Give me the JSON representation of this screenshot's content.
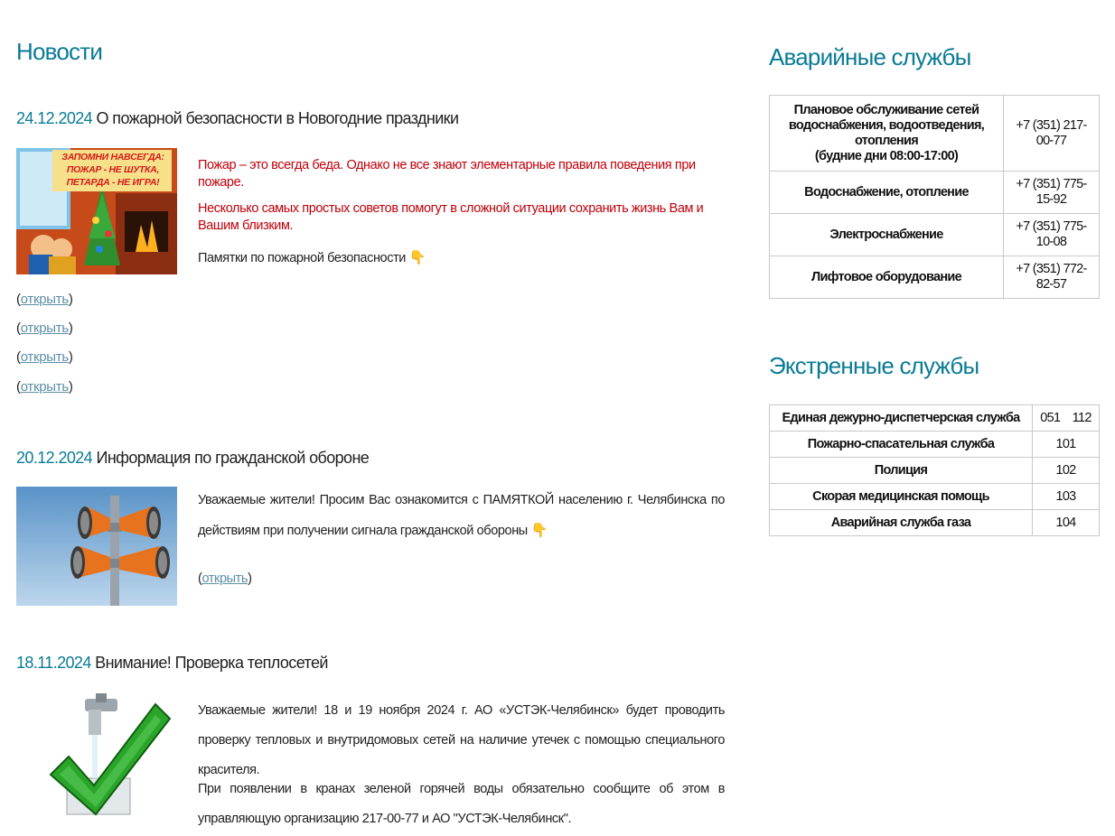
{
  "news": {
    "section_title": "Новости",
    "items": [
      {
        "date": "24.12.2024",
        "title": "О пожарной безопасности в Новогодние праздники",
        "image_caption_line1": "ЗАПОМНИ НАВСЕГДА:",
        "image_caption_line2": "ПОЖАР - НЕ ШУТКА,",
        "image_caption_line3": "ПЕТАРДА - НЕ ИГРА!",
        "p1": "Пожар – это всегда беда. Однако не все знают элементарные правила поведения при пожаре.",
        "p2": "Несколько самых простых советов помогут в сложной ситуации сохранить жизнь Вам и Вашим близким.",
        "p3": "Памятки по пожарной безопасности",
        "hand": "👇",
        "open_links": [
          "открыть",
          "открыть",
          "открыть",
          "открыть"
        ]
      },
      {
        "date": "20.12.2024",
        "title": "Информация по гражданской обороне",
        "p1": "Уважаемые жители! Просим Вас ознакомится с ПАМЯТКОЙ населению г. Челябинска по действиям при получении сигнала гражданской обороны",
        "hand": "👇",
        "open_link": "открыть"
      },
      {
        "date": "18.11.2024",
        "title": "Внимание! Проверка теплосетей",
        "p1": "Уважаемые жители! 18 и 19 ноября 2024 г. АО «УСТЭК-Челябинск» будет проводить проверку тепловых и внутридомовых сетей на наличие утечек с помощью специального красителя.",
        "p2": "При появлении в кранах зеленой горячей воды обязательно сообщите об этом в управляющую организацию 217-00-77 и АО \"УСТЭК-Челябинск\"."
      }
    ]
  },
  "emergency": {
    "title": "Аварийные службы",
    "rows": [
      {
        "name": "Плановое обслуживание сетей водоснабжения, водоотведения, отопления",
        "name2": "(будние дни 08:00-17:00)",
        "phone": "+7 (351) 217-00-77"
      },
      {
        "name": "Водоснабжение, отопление",
        "phone": "+7 (351) 775-15-92"
      },
      {
        "name": "Электроснабжение",
        "phone": "+7 (351) 775-10-08"
      },
      {
        "name": "Лифтовое оборудование",
        "phone": "+7 (351) 772-82-57"
      }
    ]
  },
  "extra": {
    "title": "Экстренные службы",
    "rows": [
      {
        "name": "Единая дежурно-диспетчерская служба",
        "phone": "051 112"
      },
      {
        "name": "Пожарно-спасательная служба",
        "phone": "101"
      },
      {
        "name": "Полиция",
        "phone": "102"
      },
      {
        "name": "Скорая медицинская помощь",
        "phone": "103"
      },
      {
        "name": "Аварийная служба газа",
        "phone": "104"
      }
    ]
  },
  "colors": {
    "accent": "#0a7b95",
    "red_text": "#c0000a",
    "link": "#5a8fa8"
  }
}
